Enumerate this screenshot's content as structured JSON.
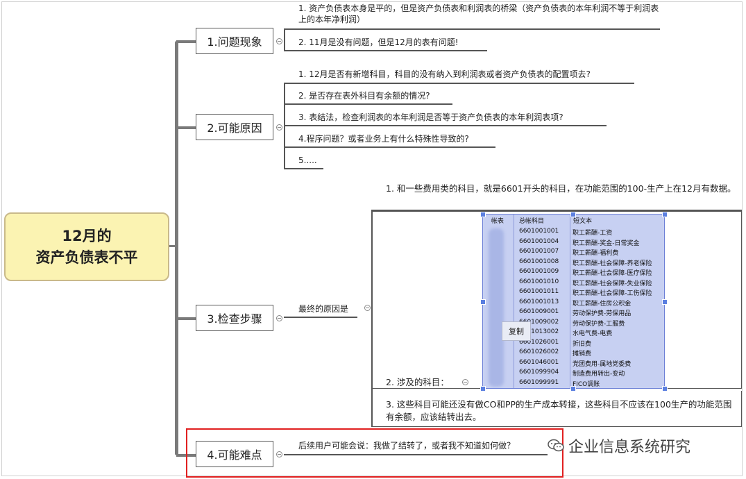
{
  "root": {
    "line1": "12月的",
    "line2": "资产负债表不平"
  },
  "nodes": [
    {
      "label": "1.问题现象"
    },
    {
      "label": "2.可能原因"
    },
    {
      "label": "3.检查步骤"
    },
    {
      "label": "4.可能难点"
    }
  ],
  "phenomena": [
    "1. 资产负债表本身是平的，但是资产负债表和利润表的桥梁（资产负债表的本年利润不等于利润表上的本年净利润）",
    "2. 11月是没有问题，但是12月的表有问题!"
  ],
  "causes": [
    "1. 12月是否有新增科目，科目的没有纳入到利润表或者资产负债表的配置项去?",
    "2. 是否存在表外科目有余额的情况?",
    "3. 表结法，检查利润表的本年利润是否等于资产负债表的本年利润表项?",
    "4.程序问题？或者业务上有什么特殊性导致的?",
    "5....."
  ],
  "check": {
    "final_reason_label": "最终的原因是",
    "item1": "1. 和一些费用类的科目，就是6601开头的科目，在功能范围的100-生产上在12月有数据。",
    "item2": "2. 涉及的科目：",
    "item3": "3. 这些科目可能还没有做CO和PP的生产成本转接，这些科目不应该在100生产的功能范围有余额，应该结转出去。"
  },
  "table": {
    "headers": [
      "帐表",
      "总帐科目",
      "短文本"
    ],
    "rows": [
      {
        "account": "6601001001",
        "text": "职工薪酬-工资"
      },
      {
        "account": "6601001004",
        "text": "职工薪酬-奖金-日常奖金"
      },
      {
        "account": "6601001007",
        "text": "职工薪酬-福利费"
      },
      {
        "account": "6601001008",
        "text": "职工薪酬-社会保障-养老保险"
      },
      {
        "account": "6601001009",
        "text": "职工薪酬-社会保障-医疗保险"
      },
      {
        "account": "6601001010",
        "text": "职工薪酬-社会保障-失业保险"
      },
      {
        "account": "6601001011",
        "text": "职工薪酬-社会保障-工伤保险"
      },
      {
        "account": "6601001013",
        "text": "职工薪酬-住房公积金"
      },
      {
        "account": "6601009001",
        "text": "劳动保护费-劳保用品"
      },
      {
        "account": "6601009002",
        "text": "劳动保护费-工服费"
      },
      {
        "account": "6601013002",
        "text": "水电气费-电费"
      },
      {
        "account": "6601026001",
        "text": "折旧费"
      },
      {
        "account": "6601026002",
        "text": "摊销费"
      },
      {
        "account": "6601046001",
        "text": "党团费用-属地党委费"
      },
      {
        "account": "6601099904",
        "text": "制造费用转出-变动"
      },
      {
        "account": "6601099991",
        "text": "FICO调账"
      }
    ],
    "copy_label": "复制"
  },
  "difficulty": {
    "text": "后续用户可能会说：我做了结转了，或者我不知道如何做？"
  },
  "watermark": {
    "text": "企业信息系统研究"
  },
  "colors": {
    "root_fill": "#fbf3b2",
    "highlight": "#e12020",
    "table_fill": "#c7d0f2"
  }
}
